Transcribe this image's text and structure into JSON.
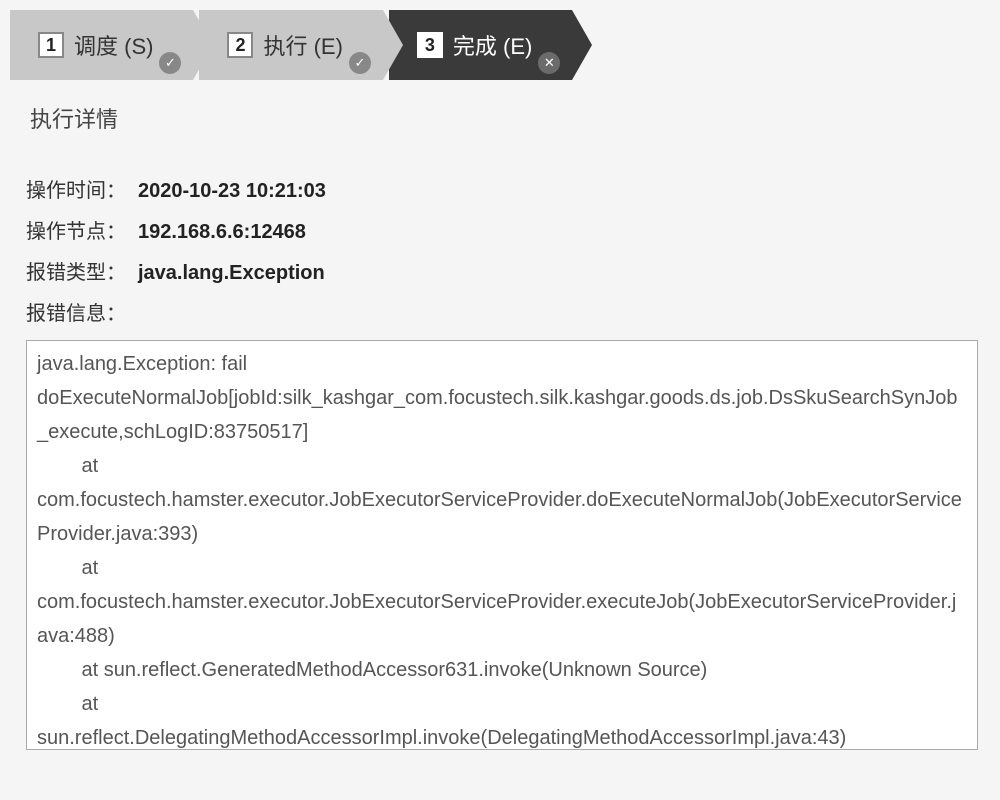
{
  "tabs": [
    {
      "num": "1",
      "label": "调度 (S)",
      "status": "check"
    },
    {
      "num": "2",
      "label": "执行 (E)",
      "status": "check"
    },
    {
      "num": "3",
      "label": "完成 (E)",
      "status": "close",
      "active": true
    }
  ],
  "section_title": "执行详情",
  "details": {
    "time_label": "操作时间：",
    "time_value": "2020-10-23 10:21:03",
    "node_label": "操作节点：",
    "node_value": "192.168.6.6:12468",
    "error_type_label": "报错类型：",
    "error_type_value": "java.lang.Exception",
    "error_msg_label": "报错信息："
  },
  "error_message": "java.lang.Exception: fail\ndoExecuteNormalJob[jobId:silk_kashgar_com.focustech.silk.kashgar.goods.ds.job.DsSkuSearchSynJob_execute,schLogID:83750517]\n        at\ncom.focustech.hamster.executor.JobExecutorServiceProvider.doExecuteNormalJob(JobExecutorServiceProvider.java:393)\n        at\ncom.focustech.hamster.executor.JobExecutorServiceProvider.executeJob(JobExecutorServiceProvider.java:488)\n        at sun.reflect.GeneratedMethodAccessor631.invoke(Unknown Source)\n        at\nsun.reflect.DelegatingMethodAccessorImpl.invoke(DelegatingMethodAccessorImpl.java:43)\n"
}
